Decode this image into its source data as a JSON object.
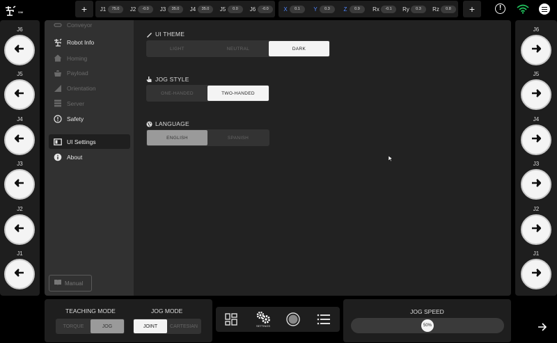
{
  "topbar": {
    "logo_badge": "SIM",
    "plus_label": "+",
    "joints": [
      {
        "label": "J1",
        "value": "75.0"
      },
      {
        "label": "J2",
        "value": "-0.0"
      },
      {
        "label": "J3",
        "value": "35.0"
      },
      {
        "label": "J4",
        "value": "35.0"
      },
      {
        "label": "J5",
        "value": "0.0"
      },
      {
        "label": "J6",
        "value": "-0.0"
      }
    ],
    "cartesian": [
      {
        "label": "X",
        "value": "0.1"
      },
      {
        "label": "Y",
        "value": "0.3"
      },
      {
        "label": "Z",
        "value": "0.9"
      },
      {
        "label": "Rx",
        "value": "-0.1"
      },
      {
        "label": "Ry",
        "value": "0.3"
      },
      {
        "label": "Rz",
        "value": "0.8"
      }
    ],
    "alert_glyph": "!",
    "wifi_color": "#22c55e"
  },
  "left_jog": [
    {
      "label": "J6",
      "icon": "arrow-left-icon"
    },
    {
      "label": "J5",
      "icon": "arrow-left-icon"
    },
    {
      "label": "J4",
      "icon": "arrow-left-icon"
    },
    {
      "label": "J3",
      "icon": "arrow-left-icon"
    },
    {
      "label": "J2",
      "icon": "arrow-left-icon"
    },
    {
      "label": "J1",
      "icon": "arrow-left-icon"
    }
  ],
  "right_jog": [
    {
      "label": "J6",
      "icon": "arrow-right-icon"
    },
    {
      "label": "J5",
      "icon": "arrow-right-icon"
    },
    {
      "label": "J4",
      "icon": "arrow-right-icon"
    },
    {
      "label": "J3",
      "icon": "arrow-right-icon"
    },
    {
      "label": "J2",
      "icon": "arrow-right-icon"
    },
    {
      "label": "J1",
      "icon": "arrow-right-icon"
    }
  ],
  "sidebar": {
    "items": [
      {
        "label": "Conveyor",
        "icon": "conveyor-icon",
        "state": "disabled"
      },
      {
        "label": "Robot Info",
        "icon": "robot-icon",
        "state": "enabled"
      },
      {
        "label": "Homing",
        "icon": "home-icon",
        "state": "disabled"
      },
      {
        "label": "Payload",
        "icon": "payload-icon",
        "state": "disabled"
      },
      {
        "label": "Orientation",
        "icon": "orientation-icon",
        "state": "disabled"
      },
      {
        "label": "Server",
        "icon": "server-icon",
        "state": "disabled"
      },
      {
        "label": "Safety",
        "icon": "safety-icon",
        "state": "enabled"
      },
      {
        "label": "UI Settings",
        "icon": "ui-settings-icon",
        "state": "active"
      },
      {
        "label": "About",
        "icon": "info-icon",
        "state": "enabled"
      }
    ],
    "manual_label": "Manual"
  },
  "main": {
    "ui_theme": {
      "title": "UI THEME",
      "options": [
        "LIGHT",
        "NEUTRAL",
        "DARK"
      ],
      "selected": "DARK"
    },
    "jog_style": {
      "title": "JOG STYLE",
      "options": [
        "ONE-HANDED",
        "TWO-HANDED"
      ],
      "selected": "TWO-HANDED"
    },
    "language": {
      "title": "LANGUAGE",
      "options": [
        "ENGLISH",
        "SPANISH"
      ],
      "selected": "ENGLISH"
    }
  },
  "bottom": {
    "teaching_mode": {
      "title": "TEACHING MODE",
      "options": [
        "TORQUE",
        "JOG"
      ],
      "selected": "JOG"
    },
    "jog_mode": {
      "title": "JOG MODE",
      "options": [
        "JOINT",
        "CARTESIAN"
      ],
      "selected": "JOINT"
    },
    "nav": {
      "settings_caption": "SETTINGS"
    },
    "jog_speed": {
      "title": "JOG SPEED",
      "value_label": "50%",
      "fraction": 0.5
    }
  }
}
